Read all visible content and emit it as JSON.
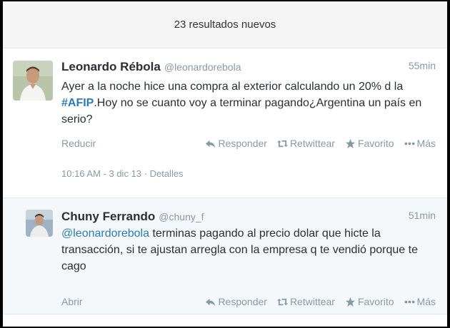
{
  "stream": {
    "new_results_label": "23 resultados nuevos"
  },
  "tweets": [
    {
      "fullname": "Leonardo Rébola",
      "username": "@leonardorebola",
      "time": "55min",
      "text_before": "Ayer a la noche hice una compra al exterior calculando un 20% d la ",
      "hashtag": "#AFIP",
      "text_after": ".Hoy no se cuanto voy a terminar pagando¿Argentina un país en serio?",
      "expand_label": "Reducir",
      "reply_label": "Responder",
      "retweet_label": "Retwittear",
      "favorite_label": "Favorito",
      "more_label": "Más",
      "datetime": "10:16 AM - 3 dic 13",
      "details_label": "Detalles"
    },
    {
      "fullname": "Chuny Ferrando",
      "username": "@chuny_f",
      "time": "51min",
      "mention": "@leonardorebola",
      "text_after": " terminas pagando al precio dolar que hicte la transacción, si te ajustan arregla con la empresa q te vendió porque te cago",
      "expand_label": "Abrir",
      "reply_label": "Responder",
      "retweet_label": "Retwittear",
      "favorite_label": "Favorito",
      "more_label": "Más"
    }
  ],
  "colors": {
    "link": "#2b7bb9",
    "muted": "#8899a6",
    "text": "#292f33"
  },
  "icons": [
    "reply-icon",
    "retweet-icon",
    "favorite-star-icon",
    "more-dots-icon"
  ]
}
